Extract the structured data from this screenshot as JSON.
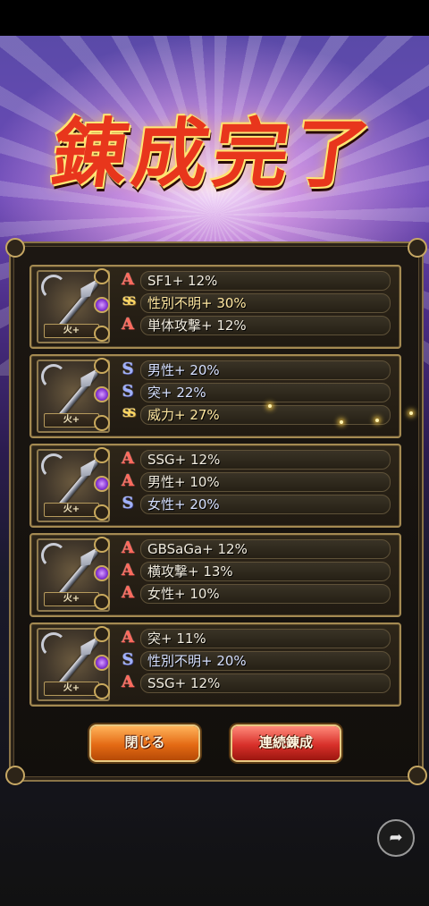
{
  "title": "錬成完了",
  "cards": [
    {
      "element_tag": "火+",
      "rows": [
        {
          "icon": "A",
          "icon_type": "a",
          "text": "SF1+ 12%"
        },
        {
          "icon": "SS",
          "icon_type": "ss",
          "text": "性別不明+ 30%"
        },
        {
          "icon": "A",
          "icon_type": "a",
          "text": "単体攻撃+ 12%"
        }
      ]
    },
    {
      "element_tag": "火+",
      "rows": [
        {
          "icon": "S",
          "icon_type": "s",
          "text": "男性+ 20%"
        },
        {
          "icon": "S",
          "icon_type": "s",
          "text": "突+ 22%"
        },
        {
          "icon": "SS",
          "icon_type": "ss",
          "text": "威力+ 27%"
        }
      ]
    },
    {
      "element_tag": "火+",
      "rows": [
        {
          "icon": "A",
          "icon_type": "a",
          "text": "SSG+ 12%"
        },
        {
          "icon": "A",
          "icon_type": "a",
          "text": "男性+ 10%"
        },
        {
          "icon": "S",
          "icon_type": "s",
          "text": "女性+ 20%"
        }
      ]
    },
    {
      "element_tag": "火+",
      "rows": [
        {
          "icon": "A",
          "icon_type": "a",
          "text": "GBSaGa+ 12%"
        },
        {
          "icon": "A",
          "icon_type": "a",
          "text": "横攻撃+ 13%"
        },
        {
          "icon": "A",
          "icon_type": "a",
          "text": "女性+ 10%"
        }
      ]
    },
    {
      "element_tag": "火+",
      "rows": [
        {
          "icon": "A",
          "icon_type": "a",
          "text": "突+ 11%"
        },
        {
          "icon": "S",
          "icon_type": "s",
          "text": "性別不明+ 20%"
        },
        {
          "icon": "A",
          "icon_type": "a",
          "text": "SSG+ 12%"
        }
      ]
    }
  ],
  "buttons": {
    "close_label": "閉じる",
    "continue_label": "連続錬成"
  },
  "share_icon": "share-icon"
}
